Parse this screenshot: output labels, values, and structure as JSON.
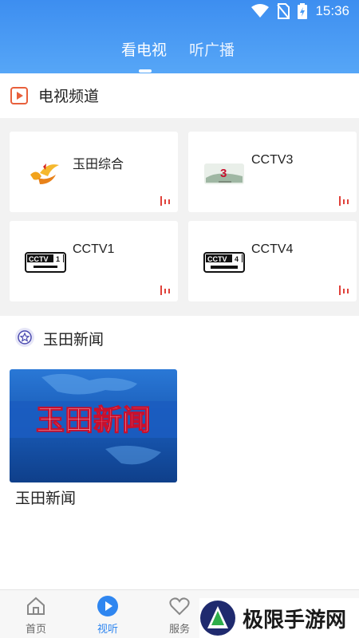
{
  "status_bar": {
    "time": "15:36"
  },
  "top_tabs": [
    {
      "label": "看电视",
      "active": true
    },
    {
      "label": "听广播",
      "active": false
    }
  ],
  "tv_section": {
    "title": "电视频道"
  },
  "channels": [
    {
      "name": "玉田综合",
      "logo": "yutian-logo"
    },
    {
      "name": "CCTV3",
      "logo": "cctv3-logo"
    },
    {
      "name": "CCTV1",
      "logo": "cctv1-logo"
    },
    {
      "name": "CCTV4",
      "logo": "cctv4-logo"
    }
  ],
  "news_section": {
    "title": "玉田新闻",
    "thumb_text": "玉田新闻",
    "item_label": "玉田新闻"
  },
  "bottom_nav": [
    {
      "label": "首页",
      "icon": "home-icon",
      "active": false
    },
    {
      "label": "视听",
      "icon": "play-icon",
      "active": true
    },
    {
      "label": "服务",
      "icon": "heart-icon",
      "active": false
    }
  ],
  "watermark": {
    "text": "极限手游网"
  },
  "colors": {
    "accent": "#2f86f0",
    "header": "#4a9bf4",
    "live": "#e0413a"
  }
}
